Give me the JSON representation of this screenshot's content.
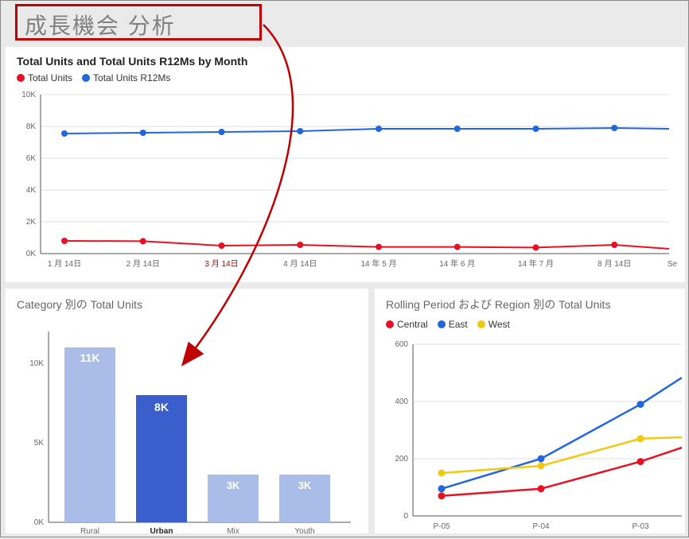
{
  "page": {
    "title": "成長機会 分析"
  },
  "chart1": {
    "title": "Total Units and Total Units R12Ms by Month",
    "legend": {
      "s0": "Total Units",
      "s1": "Total Units R12Ms"
    },
    "ylabels": {
      "y0": "0K",
      "y2": "2K",
      "y4": "4K",
      "y6": "6K",
      "y8": "8K",
      "y10": "10K"
    },
    "xlabels": {
      "x0": "1 月 14日",
      "x1": "2 月 14日",
      "x2": "3 月 14日",
      "x3": "4 月 14日",
      "x4": "14 年 5 月",
      "x5": "14 年 6 月",
      "x6": "14 年 7 月",
      "x7": "8 月 14日",
      "x8": "Se"
    }
  },
  "chart2": {
    "title": "Category 別の Total Units",
    "ylabels": {
      "y0": "0K",
      "y5": "5K",
      "y10": "10K"
    },
    "xlabels": {
      "x0": "Rural",
      "x1": "Urban",
      "x2": "Mix",
      "x3": "Youth"
    },
    "datalabels": {
      "d0": "11K",
      "d1": "8K",
      "d2": "3K",
      "d3": "3K"
    }
  },
  "chart3": {
    "title": "Rolling Period および Region 別の Total Units",
    "legend": {
      "s0": "Central",
      "s1": "East",
      "s2": "West"
    },
    "ylabels": {
      "y0": "0",
      "y200": "200",
      "y400": "400",
      "y600": "600"
    },
    "xlabels": {
      "x0": "P-05",
      "x1": "P-04",
      "x2": "P-03"
    }
  },
  "chart_data": [
    {
      "type": "line",
      "title": "Total Units and Total Units R12Ms by Month",
      "xlabel": "",
      "ylabel": "",
      "ylim": [
        0,
        10000
      ],
      "categories": [
        "1 月 14日",
        "2 月 14日",
        "3 月 14日",
        "4 月 14日",
        "14 年 5 月",
        "14 年 6 月",
        "14 年 7 月",
        "8 月 14日",
        "Se"
      ],
      "series": [
        {
          "name": "Total Units",
          "color": "#e81123",
          "values": [
            800,
            780,
            500,
            550,
            420,
            420,
            380,
            550,
            300
          ]
        },
        {
          "name": "Total Units R12Ms",
          "color": "#2266dd",
          "values": [
            7550,
            7600,
            7650,
            7700,
            7850,
            7850,
            7850,
            7900,
            7850
          ]
        }
      ]
    },
    {
      "type": "bar",
      "title": "Category 別の Total Units",
      "xlabel": "",
      "ylabel": "",
      "ylim": [
        0,
        12000
      ],
      "categories": [
        "Rural",
        "Urban",
        "Mix",
        "Youth"
      ],
      "values": [
        11000,
        8000,
        3000,
        3000
      ],
      "highlight_index": 1,
      "colors": [
        "#a9bde8",
        "#3a5ecc",
        "#a9bde8",
        "#a9bde8"
      ]
    },
    {
      "type": "line",
      "title": "Rolling Period および Region 別の Total Units",
      "xlabel": "",
      "ylabel": "",
      "ylim": [
        0,
        600
      ],
      "categories": [
        "P-05",
        "P-04",
        "P-03"
      ],
      "series": [
        {
          "name": "Central",
          "color": "#e81123",
          "values": [
            70,
            95,
            190
          ]
        },
        {
          "name": "East",
          "color": "#2266dd",
          "values": [
            95,
            200,
            390
          ]
        },
        {
          "name": "West",
          "color": "#f2c811",
          "values": [
            150,
            175,
            270
          ]
        }
      ]
    }
  ]
}
